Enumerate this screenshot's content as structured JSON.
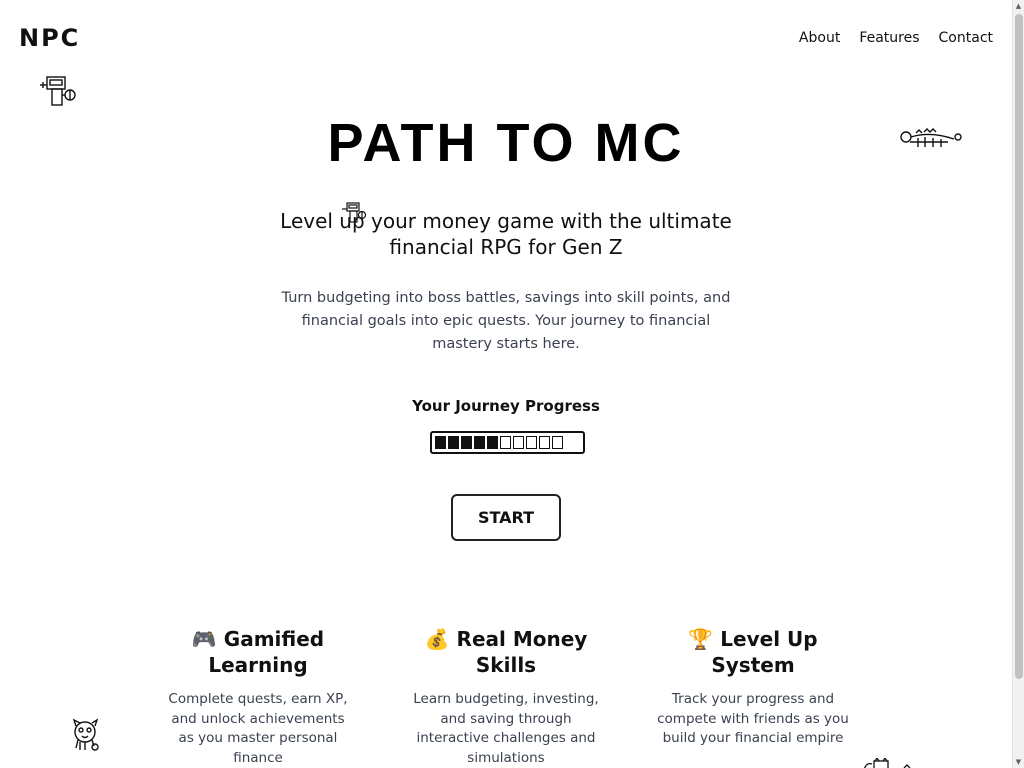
{
  "header": {
    "logo": "NPC",
    "nav": [
      "About",
      "Features",
      "Contact"
    ]
  },
  "hero": {
    "title": "PATH TO MC",
    "subtitle": "Level up your money game with the ultimate financial RPG for Gen Z",
    "description": "Turn budgeting into boss battles, savings into skill points, and financial goals into epic quests. Your journey to financial mastery starts here."
  },
  "progress": {
    "label": "Your Journey Progress",
    "filled_segments": 5,
    "total_segments": 10
  },
  "start_button": "START",
  "features": [
    {
      "emoji": "🎮",
      "title": "Gamified Learning",
      "description": "Complete quests, earn XP, and unlock achievements as you master personal finance"
    },
    {
      "emoji": "💰",
      "title": "Real Money Skills",
      "description": "Learn budgeting, investing, and saving through interactive challenges and simulations"
    },
    {
      "emoji": "🏆",
      "title": "Level Up System",
      "description": "Track your progress and compete with friends as you build your financial empire"
    }
  ],
  "decorations": [
    "robot-doodle-icon",
    "creature-doodle-icon",
    "small-robot-doodle-icon",
    "owl-doodle-icon",
    "cat-doodle-icon"
  ],
  "colors": {
    "text": "#111111",
    "muted_text": "#3a4150",
    "background": "#ffffff"
  }
}
